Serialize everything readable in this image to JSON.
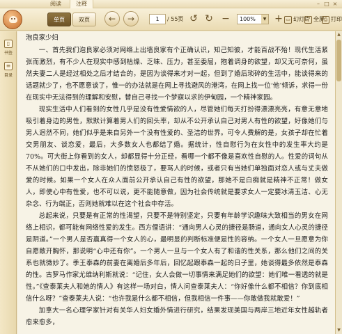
{
  "tabs": [
    {
      "label": "阅读"
    },
    {
      "label": "注释"
    }
  ],
  "toolbar": {
    "single_page": "单页",
    "double_page": "双页",
    "current_page": "1",
    "total_pages": "/ 55页",
    "zoom": "100%",
    "slideshow": "幻灯片",
    "fullscreen": "全屏",
    "print": "打印"
  },
  "sidebar": {
    "items": [
      {
        "label": "书签"
      },
      {
        "label": "目录"
      }
    ]
  },
  "document": {
    "title": "泡良家少妇",
    "paragraphs": [
      "一、首先我们泡良家必须对网络上出墙良家有个正确认识，知己知彼，才能百战不殆！现代生活紧张而激烈，有不少人在现实中感到枯燥、乏味、压力，甚至委屈，抱着调身的欲望，却又无可奈何，虽然夫妻二人是经过相处之后才结合的，是因为谈得来才对一起，但到了婚后琐碎的生活中，能谈得来的话题就少了，也不愿意谈了，惟一的办法就是在网上寻找避风的港湾，在网上找一位‘他’倾诉，求得一份在现实中无法得到的理解和安慰，替自己寻找一个梦寐以求的伊甸园，一个精神家园。",
      "现实生活中人们看到的女性几乎是没有性爱情欲的人，尽管她们每天打扮得漂漂亮亮，有意无意地吸引着身边的男性，默默计算着男人们的回头率，却从不公开承认自己对男人有性的欲望，好像她们与男人迥然不同，她们似乎是来自另外一个没有性爱的、圣洁的世界。可令人费解的是，女孩子却在忙着交男朋友、谈恋爱，最后，大多数女人也都结了婚。据统计，性自慰行为在女性中的发生率大约是70%。可大街上你看到的女人，却都显得十分正经，看哪一个都不像是喜欢性自慰的人。性爱的词句从不从她们的口中发出，除非她们的愤怒极了，要骂人的时候，或者只有当她们单独面对恋人或与丈夫做爱的时候。如果一个女人在众人面前公开承认自己有性的欲望，那她不是白痴就是精神不正常！做女人，即使心中有性爱，也不可以说，更不能随意做，因为社会传统就是要求女人一定要冰清玉洁、心无杂念、行为端正，否则她就难以在这个社会中存活。",
      "总起来说，只要是有正常的性渴望，只要不是特别坚定，只要有年龄学识趣味大致相当的男女在网络上相识，都可能有网络性爱的发生。西方俚语讲：“通向男人心灵的捷径是肠道，通向女人心灵的捷径是阴道。”一个男人是否赢真得一个女人的心，最明显的判断标准便是性的容纳。一个女人一旦愿意为你自愿敞开胸怀，那说明“心中还有你”。一个男人一旦与一个女人有了和谐的性关系，那么他们之间的关系也就微妙了。季王泰森的前妻在离婚后多年后，回忆起跟泰森一起的日子里，她谈得最多依然是泰森的性。古罗马作家尤维纳利斯就说：“记住，女人会做一切事情来满足她们的欲望：她们唯一看透的就是性。”《查泰莱夫人和她的情人》有这样一场对白，情人问查泰莱夫人：“你好像什么都不相信？你到底相信什么呀？”查泰莱夫人说：“也许我是什么都不相信，但我相信一件事——你敢做我就敢爱！”",
      "加拿大一名心理学家针对有关华人妇女婚外情进行研究，结果发现美国与两岸三地近年女性越轨者愈来愈多，"
    ]
  }
}
